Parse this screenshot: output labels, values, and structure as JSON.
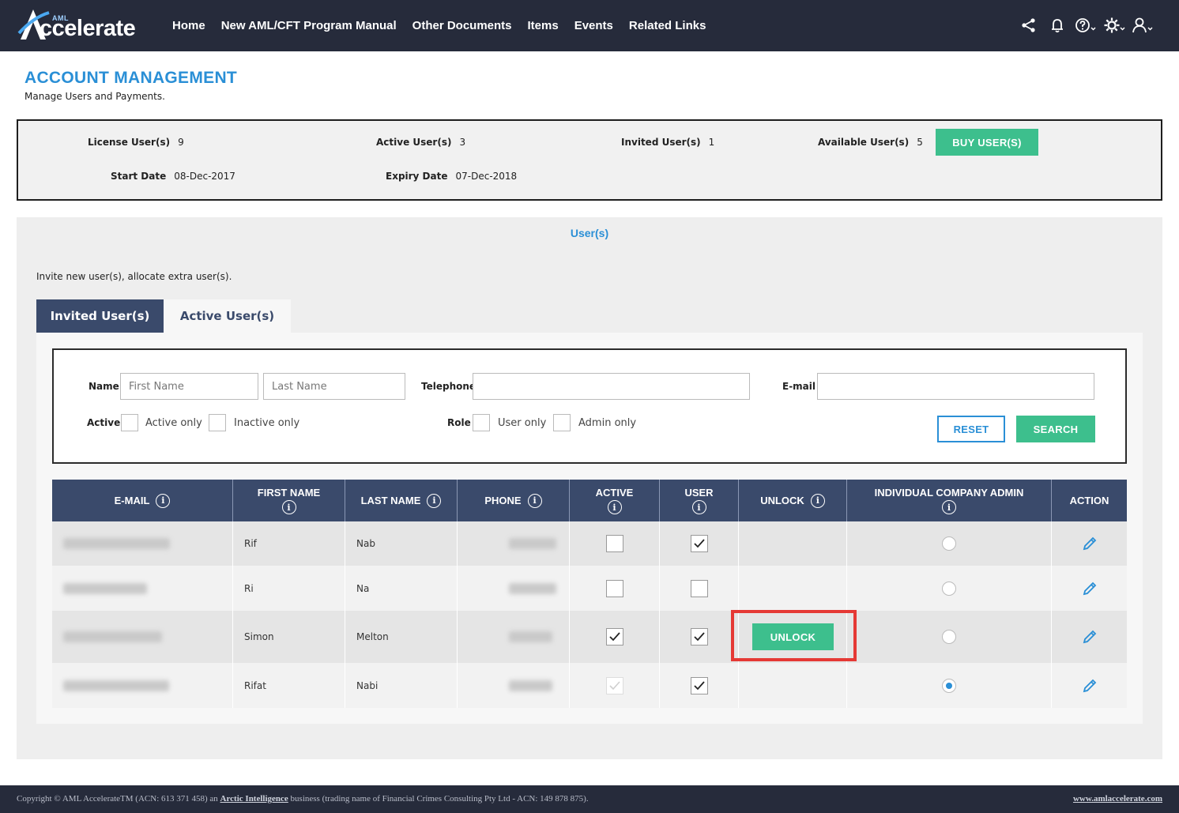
{
  "brand": {
    "aml": "AML",
    "name": "ccelerate"
  },
  "nav": [
    "Home",
    "New AML/CFT Program Manual",
    "Other Documents",
    "Items",
    "Events",
    "Related Links"
  ],
  "header": {
    "title": "ACCOUNT MANAGEMENT",
    "subtitle": "Manage Users and Payments."
  },
  "summary": {
    "license_label": "License User(s)",
    "license_value": "9",
    "active_label": "Active User(s)",
    "active_value": "3",
    "invited_label": "Invited User(s)",
    "invited_value": "1",
    "available_label": "Available User(s)",
    "available_value": "5",
    "start_label": "Start Date",
    "start_value": "08-Dec-2017",
    "expiry_label": "Expiry Date",
    "expiry_value": "07-Dec-2018",
    "buy_button": "BUY USER(S)"
  },
  "users": {
    "title": "User(s)",
    "description": "Invite new user(s), allocate extra user(s).",
    "tabs": [
      "Invited User(s)",
      "Active User(s)"
    ]
  },
  "filter": {
    "name_label": "Name",
    "first_placeholder": "First Name",
    "last_placeholder": "Last Name",
    "telephone_label": "Telephone",
    "email_label": "E-mail",
    "active_label": "Active",
    "active_only": "Active only",
    "inactive_only": "Inactive only",
    "role_label": "Role",
    "user_only": "User only",
    "admin_only": "Admin only",
    "reset": "RESET",
    "search": "SEARCH"
  },
  "table": {
    "headers": [
      "E-MAIL",
      "FIRST NAME",
      "LAST NAME",
      "PHONE",
      "ACTIVE",
      "USER",
      "UNLOCK",
      "INDIVIDUAL COMPANY ADMIN",
      "ACTION"
    ],
    "rows": [
      {
        "first": "Rif",
        "last": "Nab",
        "active": false,
        "user": true,
        "unlock": false,
        "admin": false
      },
      {
        "first": "Ri",
        "last": "Na",
        "active": false,
        "user": false,
        "unlock": false,
        "admin": false
      },
      {
        "first": "Simon",
        "last": "Melton",
        "active": true,
        "user": true,
        "unlock": true,
        "admin": false
      },
      {
        "first": "Rifat",
        "last": "Nabi",
        "active": true,
        "user": true,
        "unlock": false,
        "admin": true,
        "active_disabled": true
      }
    ],
    "unlock_label": "UNLOCK"
  },
  "footer": {
    "copy_pre": "Copyright © AML AccelerateTM (ACN: 613 371 458) an ",
    "copy_link": "Arctic Intelligence",
    "copy_post": " business (trading name of Financial Crimes Consulting Pty Ltd - ACN: 149 878 875).",
    "site": "www.amlaccelerate.com"
  },
  "colors": {
    "nav_bg": "#262b3b",
    "accent_blue": "#2a8fd6",
    "accent_green": "#3dbf8d",
    "table_header": "#3a4a6b",
    "highlight": "#e53935"
  },
  "icons": [
    "share-icon",
    "bell-icon",
    "help-icon",
    "gear-icon",
    "user-icon",
    "info-icon",
    "check-icon",
    "pencil-icon"
  ]
}
